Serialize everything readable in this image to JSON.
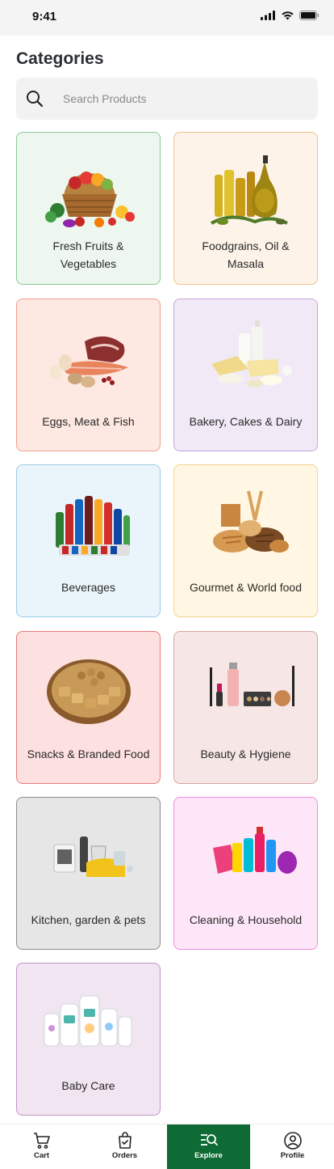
{
  "status_bar": {
    "time": "9:41"
  },
  "page": {
    "title": "Categories"
  },
  "search": {
    "placeholder": "Search Products"
  },
  "categories": [
    {
      "label": "Fresh Fruits & Vegetables",
      "bg": "#eef7ef",
      "border": "#8cc79a"
    },
    {
      "label": "Foodgrains, Oil & Masala",
      "bg": "#fdf3e8",
      "border": "#f2c38a"
    },
    {
      "label": "Eggs, Meat & Fish",
      "bg": "#fde8e2",
      "border": "#f0a08e"
    },
    {
      "label": "Bakery, Cakes & Dairy",
      "bg": "#f1eaf6",
      "border": "#c3a6dc"
    },
    {
      "label": "Beverages",
      "bg": "#eaf4fb",
      "border": "#9ccbea"
    },
    {
      "label": "Gourmet & World food",
      "bg": "#fff7e3",
      "border": "#f2d48a"
    },
    {
      "label": "Snacks & Branded Food",
      "bg": "#fde0e0",
      "border": "#e77b7b"
    },
    {
      "label": "Beauty & Hygiene",
      "bg": "#f6e6e5",
      "border": "#d7a6a2"
    },
    {
      "label": "Kitchen, garden & pets",
      "bg": "#e6e6e6",
      "border": "#8d8d8d"
    },
    {
      "label": "Cleaning & Household",
      "bg": "#fde6f7",
      "border": "#f08ee0"
    },
    {
      "label": "Baby Care",
      "bg": "#f0e5f1",
      "border": "#c594c8"
    }
  ],
  "bottom_nav": {
    "active_color": "#0e6b36",
    "items": [
      {
        "label": "Cart",
        "icon": "cart-icon"
      },
      {
        "label": "Orders",
        "icon": "orders-bag-icon"
      },
      {
        "label": "Explore",
        "icon": "explore-icon"
      },
      {
        "label": "Profile",
        "icon": "profile-icon"
      }
    ]
  }
}
